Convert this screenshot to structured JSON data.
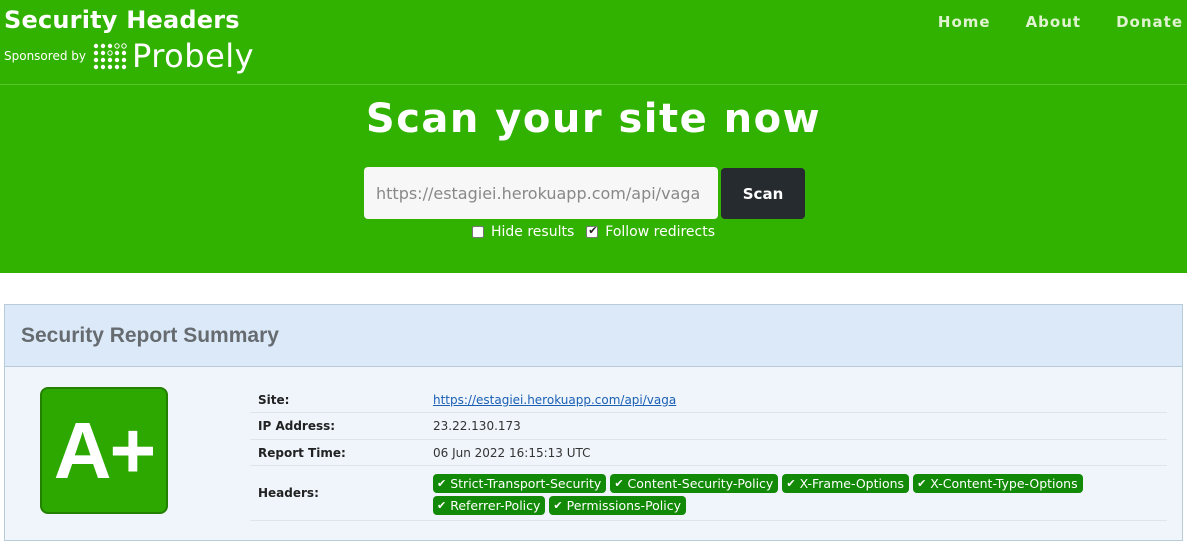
{
  "brand": {
    "title": "Security Headers",
    "sponsored_label": "Sponsored by",
    "sponsor_name": "Probely"
  },
  "nav": [
    "Home",
    "About",
    "Donate"
  ],
  "hero": {
    "headline": "Scan your site now",
    "url_value": "https://estagiei.herokuapp.com/api/vaga",
    "scan_label": "Scan",
    "hide_results_label": "Hide results",
    "hide_results_checked": false,
    "follow_redirects_label": "Follow redirects",
    "follow_redirects_checked": true
  },
  "report": {
    "title": "Security Report Summary",
    "grade": "A+",
    "rows": {
      "site_label": "Site:",
      "site_value": "https://estagiei.herokuapp.com/api/vaga",
      "ip_label": "IP Address:",
      "ip_value": "23.22.130.173",
      "time_label": "Report Time:",
      "time_value": "06 Jun 2022 16:15:13 UTC",
      "headers_label": "Headers:"
    },
    "headers": [
      "Strict-Transport-Security",
      "Content-Security-Policy",
      "X-Frame-Options",
      "X-Content-Type-Options",
      "Referrer-Policy",
      "Permissions-Policy"
    ]
  },
  "colors": {
    "hero_green": "#32b200",
    "grade_green": "#2da800",
    "badge_green": "#138a07",
    "scan_button": "#262b30"
  },
  "icons": {
    "badge_check": "check-icon",
    "sponsor_logo": "probely-logo-icon"
  }
}
